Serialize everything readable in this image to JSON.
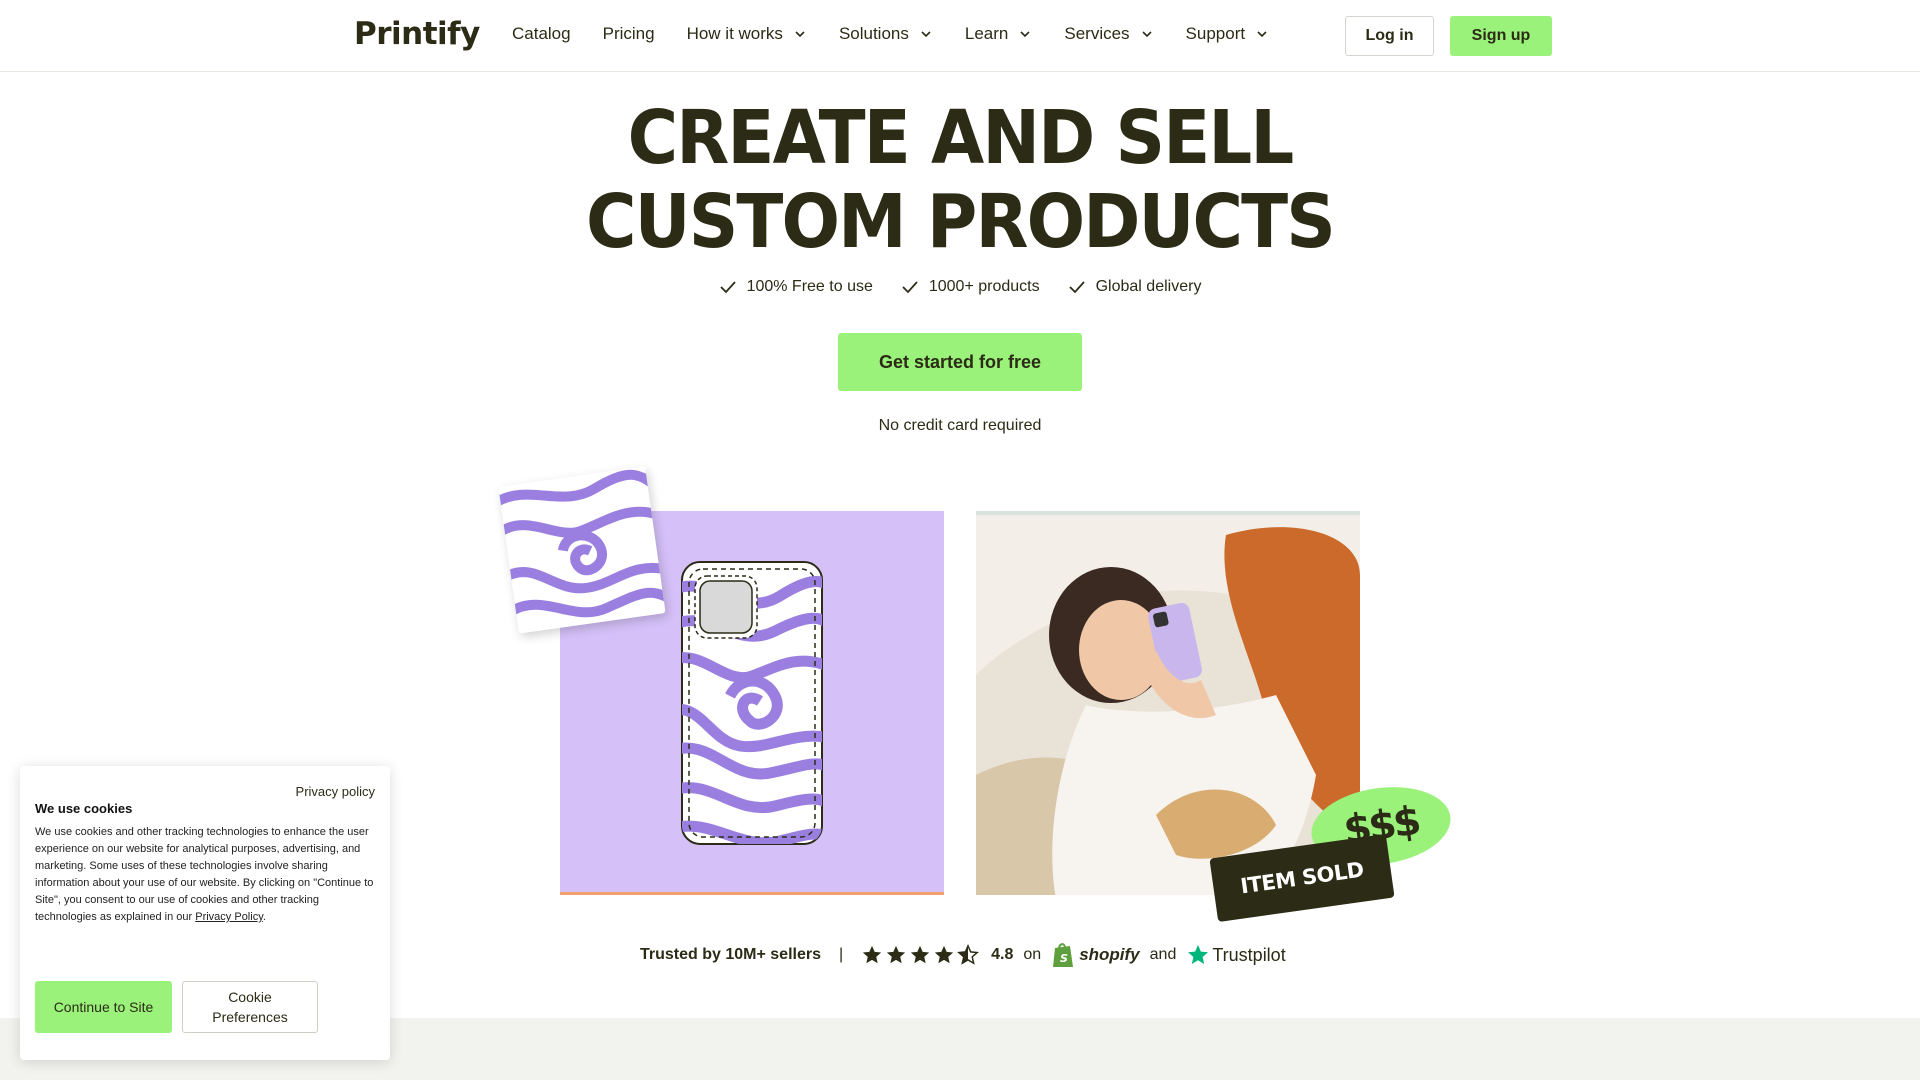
{
  "header": {
    "logo": "Printify",
    "nav": [
      {
        "label": "Catalog",
        "dropdown": false
      },
      {
        "label": "Pricing",
        "dropdown": false
      },
      {
        "label": "How it works",
        "dropdown": true
      },
      {
        "label": "Solutions",
        "dropdown": true
      },
      {
        "label": "Learn",
        "dropdown": true
      },
      {
        "label": "Services",
        "dropdown": true
      },
      {
        "label": "Support",
        "dropdown": true
      }
    ],
    "login_label": "Log in",
    "signup_label": "Sign up"
  },
  "hero": {
    "title_line1": "CREATE AND SELL",
    "title_line2": "CUSTOM PRODUCTS",
    "features": [
      "100% Free to use",
      "1000+ products",
      "Global delivery"
    ],
    "cta_label": "Get started for free",
    "cta_note": "No credit card required"
  },
  "showcase": {
    "item_sold_label": "ITEM SOLD",
    "money_label": "$$$"
  },
  "trust": {
    "text": "Trusted by 10M+ sellers",
    "separator": "|",
    "rating": "4.8",
    "on": "on",
    "shopify": "shopify",
    "and": "and",
    "trustpilot": "Trustpilot",
    "stars": 4.5
  },
  "cookie": {
    "privacy_link": "Privacy policy",
    "title": "We use cookies",
    "body": "We use cookies and other tracking technologies to enhance the user experience on our website for analytical purposes, advertising, and marketing. Some uses of these technologies involve sharing information about your use of our website. By clicking on \"Continue to Site\", you consent to our use of cookies and other tracking technologies as explained in our",
    "body_link": "Privacy Policy",
    "continue_label": "Continue to Site",
    "prefs_label_1": "Cookie",
    "prefs_label_2": "Preferences"
  },
  "colors": {
    "accent": "#9af27a",
    "text": "#2b2b16",
    "purple": "#d5c0f8",
    "swirl": "#9b7fe0"
  }
}
